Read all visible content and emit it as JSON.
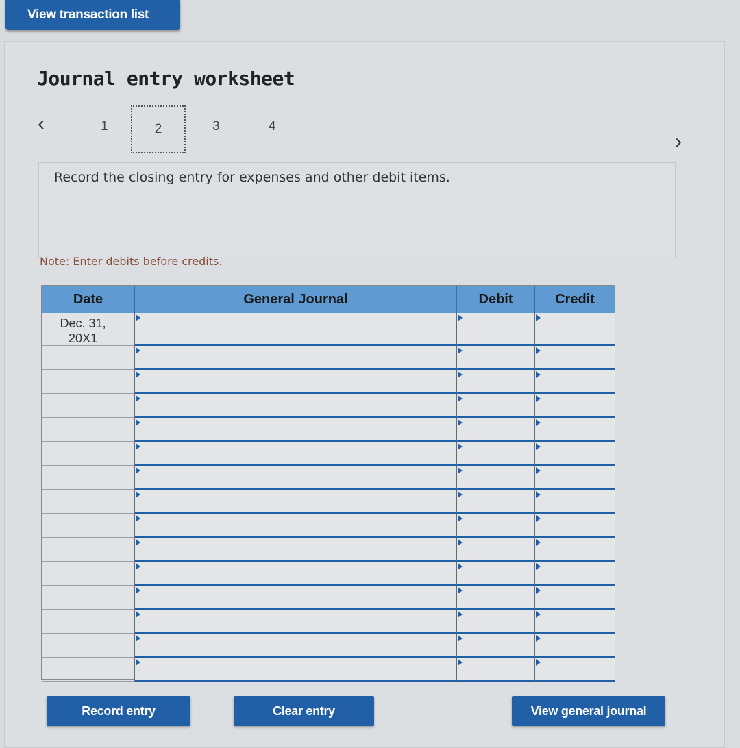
{
  "top_button": "View transaction list",
  "title": "Journal entry worksheet",
  "pager": {
    "prev_icon": "chevron-left-icon",
    "next_icon": "chevron-right-icon",
    "pages": [
      "1",
      "2",
      "3",
      "4"
    ],
    "active": "2"
  },
  "instruction": "Record the closing entry for expenses and other debit items.",
  "note": "Note: Enter debits before credits.",
  "table": {
    "headers": {
      "date": "Date",
      "general_journal": "General Journal",
      "debit": "Debit",
      "credit": "Credit"
    },
    "rows": [
      {
        "date": "Dec. 31,\n20X1",
        "account": "",
        "debit": "",
        "credit": ""
      },
      {
        "date": "",
        "account": "",
        "debit": "",
        "credit": ""
      },
      {
        "date": "",
        "account": "",
        "debit": "",
        "credit": ""
      },
      {
        "date": "",
        "account": "",
        "debit": "",
        "credit": ""
      },
      {
        "date": "",
        "account": "",
        "debit": "",
        "credit": ""
      },
      {
        "date": "",
        "account": "",
        "debit": "",
        "credit": ""
      },
      {
        "date": "",
        "account": "",
        "debit": "",
        "credit": ""
      },
      {
        "date": "",
        "account": "",
        "debit": "",
        "credit": ""
      },
      {
        "date": "",
        "account": "",
        "debit": "",
        "credit": ""
      },
      {
        "date": "",
        "account": "",
        "debit": "",
        "credit": ""
      },
      {
        "date": "",
        "account": "",
        "debit": "",
        "credit": ""
      },
      {
        "date": "",
        "account": "",
        "debit": "",
        "credit": ""
      },
      {
        "date": "",
        "account": "",
        "debit": "",
        "credit": ""
      },
      {
        "date": "",
        "account": "",
        "debit": "",
        "credit": ""
      },
      {
        "date": "",
        "account": "",
        "debit": "",
        "credit": ""
      }
    ]
  },
  "buttons": {
    "record": "Record entry",
    "clear": "Clear entry",
    "view_journal": "View general journal"
  },
  "colors": {
    "accent": "#215fa6",
    "header": "#5f9ad3",
    "note": "#8a4a3e"
  }
}
